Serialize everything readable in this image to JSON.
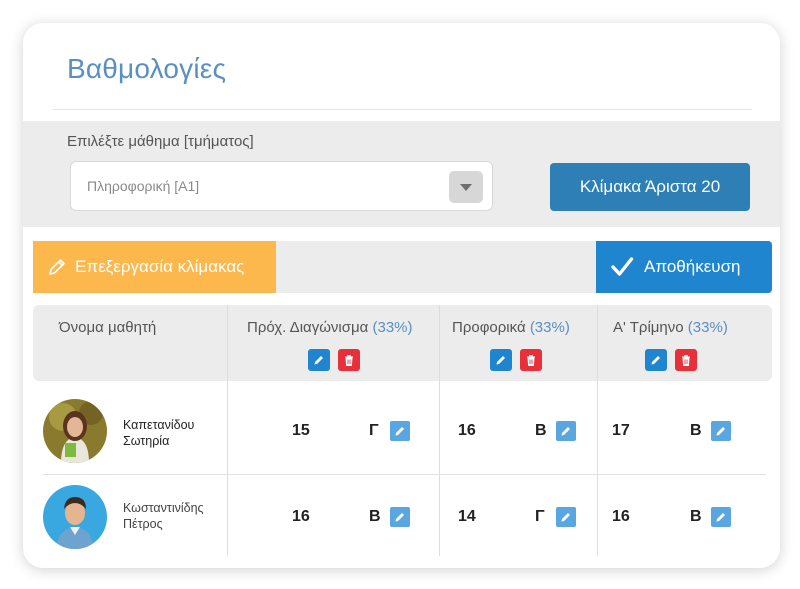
{
  "header": {
    "title": "Βαθμολογίες"
  },
  "filter": {
    "label": "Επιλέξτε μάθημα [τμήματος]",
    "selected_course": "Πληροφορική [Α1]",
    "scale_button": "Κλίμακα Άριστα 20"
  },
  "toolbar": {
    "edit_scale_label": "Επεξεργασία κλίμακας",
    "save_label": "Αποθήκευση"
  },
  "table": {
    "columns": [
      {
        "label": "Όνομα μαθητή",
        "weight": ""
      },
      {
        "label": "Πρόχ. Διαγώνισμα",
        "weight": "(33%)"
      },
      {
        "label": "Προφορικά",
        "weight": "(33%)"
      },
      {
        "label": "Α' Τρίμηνο",
        "weight": "(33%)"
      }
    ],
    "rows": [
      {
        "name_line1": "Καπετανίδου",
        "name_line2": "Σωτηρία",
        "grades": [
          {
            "value": "15",
            "letter": "Γ"
          },
          {
            "value": "16",
            "letter": "Β"
          },
          {
            "value": "17",
            "letter": "Β"
          }
        ]
      },
      {
        "name_line1": "Κωσταντινίδης",
        "name_line2": "Πέτρος",
        "grades": [
          {
            "value": "16",
            "letter": "Β"
          },
          {
            "value": "14",
            "letter": "Γ"
          },
          {
            "value": "16",
            "letter": "Β"
          }
        ]
      }
    ]
  },
  "icons": {
    "edit": "pencil-icon",
    "delete": "trash-icon",
    "save": "check-icon"
  },
  "colors": {
    "accent_blue": "#1f85cf",
    "scale_button": "#2f7fb7",
    "edit_orange": "#fcb84c",
    "delete_red": "#e8303b",
    "title_blue": "#5a8fc4"
  }
}
